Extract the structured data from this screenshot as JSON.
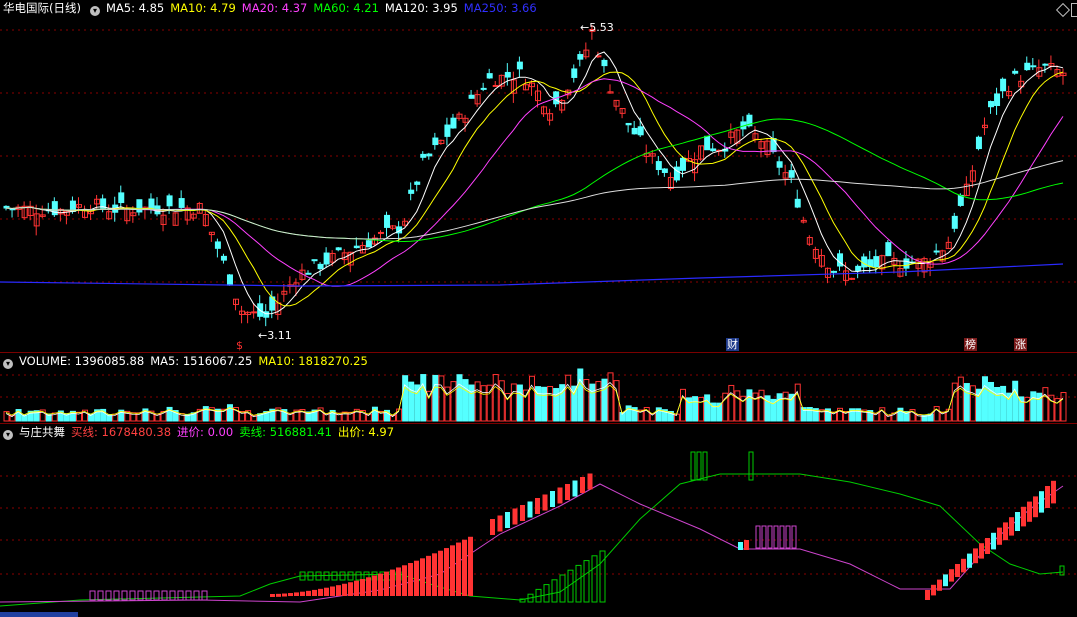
{
  "main": {
    "stock_name": "华电国际",
    "period": "(日线)",
    "ma": [
      {
        "label": "MA5: 4.85",
        "color": "#ffffff"
      },
      {
        "label": "MA10: 4.79",
        "color": "#ffff00"
      },
      {
        "label": "MA20: 4.37",
        "color": "#ff40ff"
      },
      {
        "label": "MA60: 4.21",
        "color": "#00ff00"
      },
      {
        "label": "MA120: 3.95",
        "color": "#ffffff"
      },
      {
        "label": "MA250: 3.66",
        "color": "#2a2aff"
      }
    ],
    "high_marker": "5.53",
    "low_marker": "3.11",
    "event_tags": [
      {
        "text": "$",
        "color": "#ff3030",
        "bg": "#000000",
        "icon": "dollar-icon"
      },
      {
        "text": "财",
        "color": "#ffffff",
        "bg": "#1e3a8a",
        "icon": "finance-report-icon"
      },
      {
        "text": "榜",
        "color": "#ffffff",
        "bg": "#7a1a1a",
        "icon": "ranking-list-icon"
      },
      {
        "text": "涨",
        "color": "#ffffff",
        "bg": "#7a1a1a",
        "icon": "limit-up-icon"
      }
    ],
    "up_color": "#ff3333",
    "down_color": "#54ffff"
  },
  "volume": {
    "label": "VOLUME: 1396085.88",
    "ma5": "MA5: 1516067.25",
    "ma10": "MA10: 1818270.25"
  },
  "indicator": {
    "name": "与庄共舞",
    "buy_line": "买线: 1678480.38",
    "entry_price": "进价: 0.00",
    "sell_line": "卖线: 516881.41",
    "exit_price": "出价: 4.97"
  },
  "bottom_tab": "..."
}
